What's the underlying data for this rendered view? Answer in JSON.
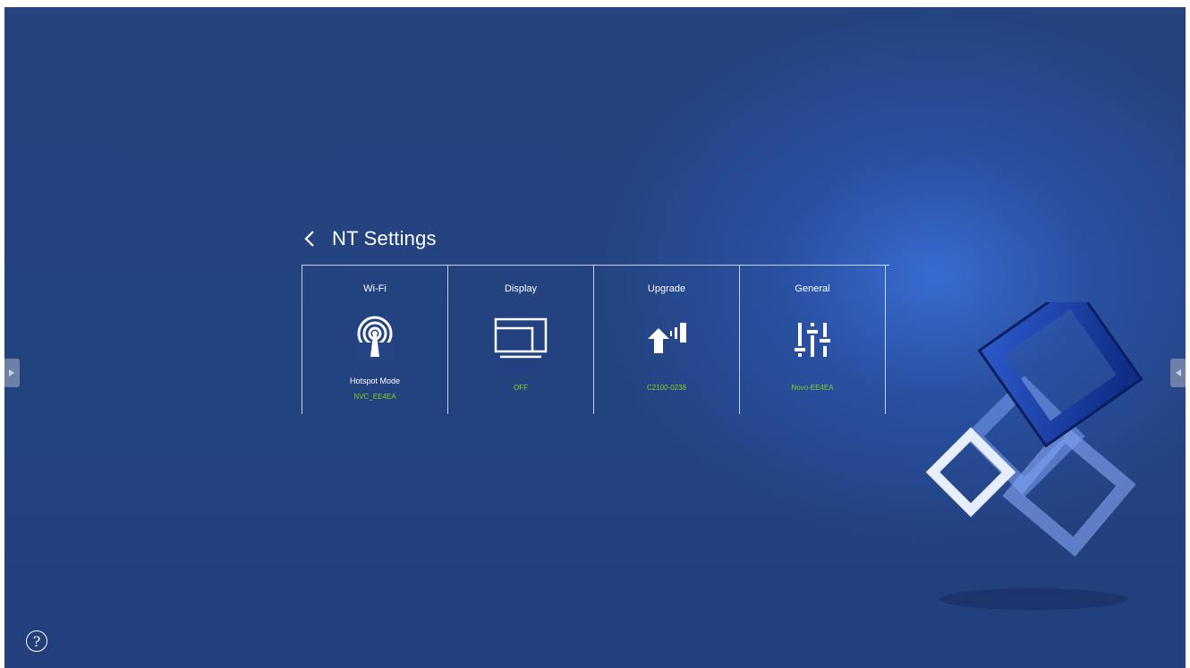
{
  "header": {
    "title": "NT Settings",
    "back_icon": "chevron-left-icon"
  },
  "cards": [
    {
      "label": "Wi-Fi",
      "icon": "wifi-hotspot-icon",
      "sub": "Hotspot Mode",
      "value": "NVC_EE4EA"
    },
    {
      "label": "Display",
      "icon": "display-icon",
      "value": "OFF"
    },
    {
      "label": "Upgrade",
      "icon": "upgrade-icon",
      "value": "C2100-0238"
    },
    {
      "label": "General",
      "icon": "sliders-icon",
      "value": "Novo-EE4EA"
    }
  ],
  "help": {
    "label": "?",
    "icon": "help-icon"
  },
  "colors": {
    "accent": "#7fd321",
    "background": "#24437f",
    "text": "#ffffff"
  }
}
